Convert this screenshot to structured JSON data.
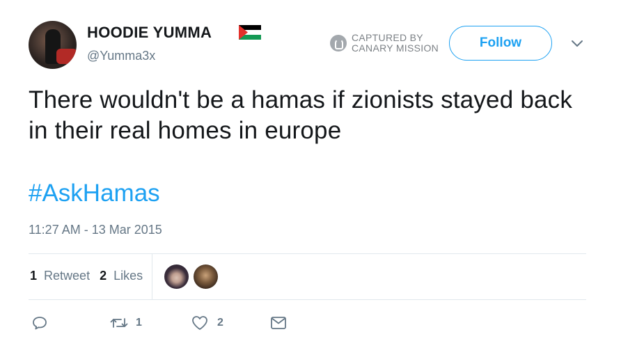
{
  "user": {
    "display_name": "HOODIE YUMMA",
    "handle": "@Yumma3x",
    "flag_icon": "palestine-flag-icon"
  },
  "watermark": {
    "line1": "CAPTURED BY",
    "line2": "CANARY MISSION"
  },
  "follow_label": "Follow",
  "tweet": {
    "text": "There wouldn't be a hamas if zionists stayed back in their real homes in europe",
    "hashtag": "#AskHamas",
    "timestamp": "11:27 AM - 13 Mar 2015"
  },
  "stats": {
    "retweets_count": "1",
    "retweets_label": "Retweet",
    "likes_count": "2",
    "likes_label": "Likes"
  },
  "actions": {
    "reply_icon": "reply-icon",
    "retweet_icon": "retweet-icon",
    "retweet_count": "1",
    "like_icon": "heart-icon",
    "like_count": "2",
    "dm_icon": "envelope-icon"
  },
  "colors": {
    "accent": "#1da1f2",
    "muted": "#657786",
    "text": "#14171a"
  }
}
